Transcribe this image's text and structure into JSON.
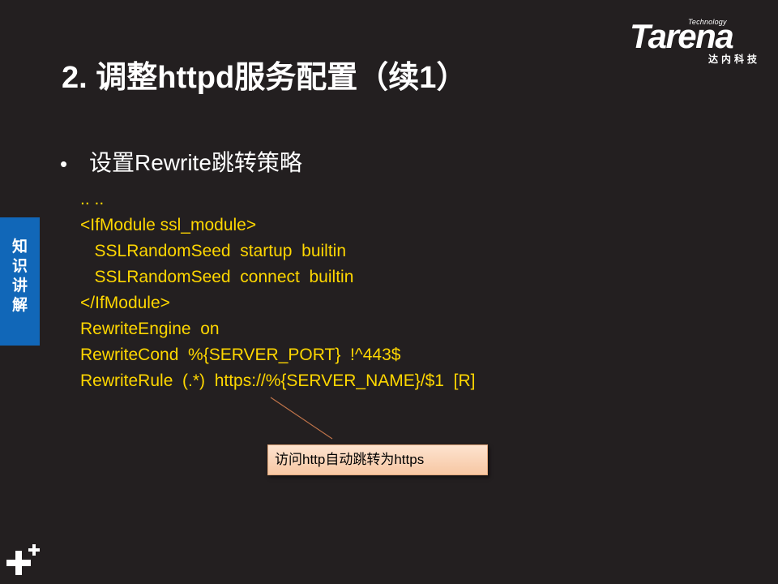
{
  "logo": {
    "technology": "Technology",
    "wordmark": "Tarena",
    "subtitle": "达内科技"
  },
  "title": "2. 调整httpd服务配置（续1）",
  "bullet": "设置Rewrite跳转策略",
  "code_lines": [
    ".. ..",
    "<IfModule ssl_module>",
    "   SSLRandomSeed  startup  builtin",
    "   SSLRandomSeed  connect  builtin",
    "</IfModule>",
    "RewriteEngine  on",
    "RewriteCond  %{SERVER_PORT}  !^443$",
    "RewriteRule  (.*)  https://%{SERVER_NAME}/$1  [R]"
  ],
  "side_tab": {
    "chars": [
      "知",
      "识",
      "讲",
      "解"
    ],
    "color": "#1167b8"
  },
  "callout": {
    "text": "访问http自动跳转为https"
  },
  "colors": {
    "background": "#231f20",
    "code": "#ffd700",
    "accent": "#1167b8"
  },
  "icons": {
    "corner": "plus-icon"
  }
}
